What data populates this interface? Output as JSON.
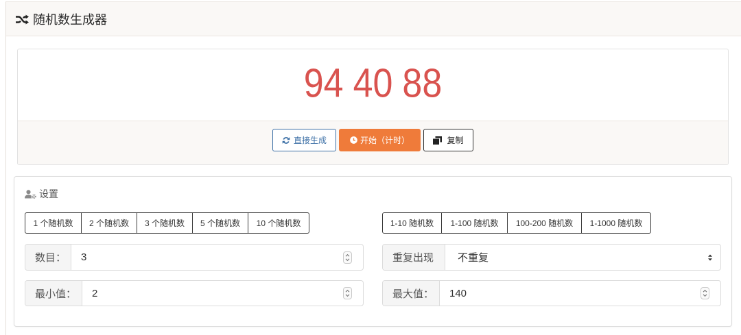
{
  "app": {
    "title": "随机数生成器",
    "title_icon": "shuffle-icon"
  },
  "result": {
    "values": [
      94,
      40,
      88
    ]
  },
  "actions": {
    "generate": {
      "label": "直接生成",
      "icon": "refresh-icon"
    },
    "start_timer": {
      "label": "开始（计时）",
      "icon": "clock-icon"
    },
    "copy": {
      "label": "复制",
      "icon": "copy-icon"
    }
  },
  "settings": {
    "title": "设置",
    "title_icon": "user-gear-icon",
    "count_presets": [
      "1 个随机数",
      "2 个随机数",
      "3 个随机数",
      "5 个随机数",
      "10 个随机数"
    ],
    "range_presets": [
      "1-10 随机数",
      "1-100 随机数",
      "100-200 随机数",
      "1-1000 随机数"
    ],
    "count": {
      "label": "数目：",
      "value": "3",
      "icon": "spinner-arrows-icon"
    },
    "repeat": {
      "label": "重复出现",
      "selected": "不重复",
      "icon": "select-arrows-icon"
    },
    "min": {
      "label": "最小值：",
      "value": "2",
      "icon": "spinner-arrows-icon"
    },
    "max": {
      "label": "最大值：",
      "value": "140",
      "icon": "spinner-arrows-icon"
    }
  },
  "colors": {
    "result_text": "#d9534f",
    "primary_outline": "#3a6ea5",
    "start_button": "#ef7b3a",
    "panel_bg": "#faf8f6"
  }
}
